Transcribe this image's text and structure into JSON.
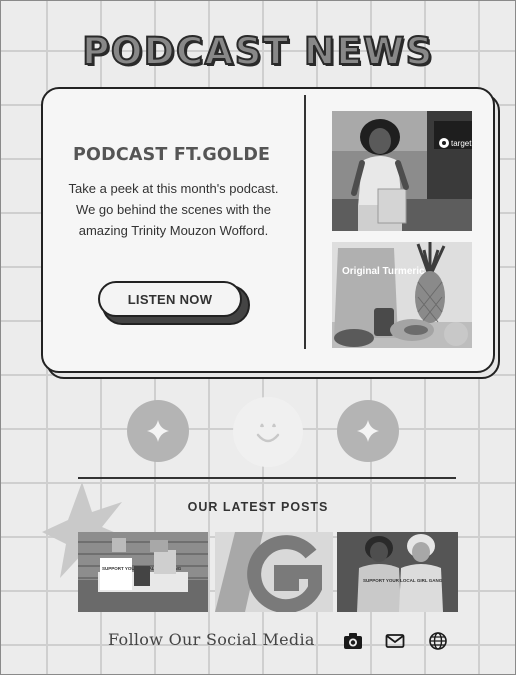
{
  "page": {
    "title": "PODCAST NEWS"
  },
  "feature": {
    "heading": "PODCAST FT.GOLDE",
    "description": "Take a peek at this month's podcast. We go behind the scenes with the amazing Trinity Mouzon Wofford.",
    "button_label": "LISTEN NOW",
    "photo_store_sign": "target",
    "product_label": "Original Turmeric"
  },
  "posts": {
    "heading": "OUR LATEST POSTS",
    "post1_sign_text": "SUPPORT YOUR LOCAL GIRL GANG",
    "post3_shirt_text": "SUPPORT YOUR LOCAL GIRL GANG"
  },
  "footer": {
    "follow_text": "Follow Our Social Media",
    "icons": [
      "camera-icon",
      "mail-icon",
      "globe-icon"
    ]
  },
  "colors": {
    "background": "#ececec",
    "grid_line": "#cfcfcf",
    "card": "#f6f6f6",
    "outline": "#222222",
    "circle_gray": "#b4b4b4"
  }
}
